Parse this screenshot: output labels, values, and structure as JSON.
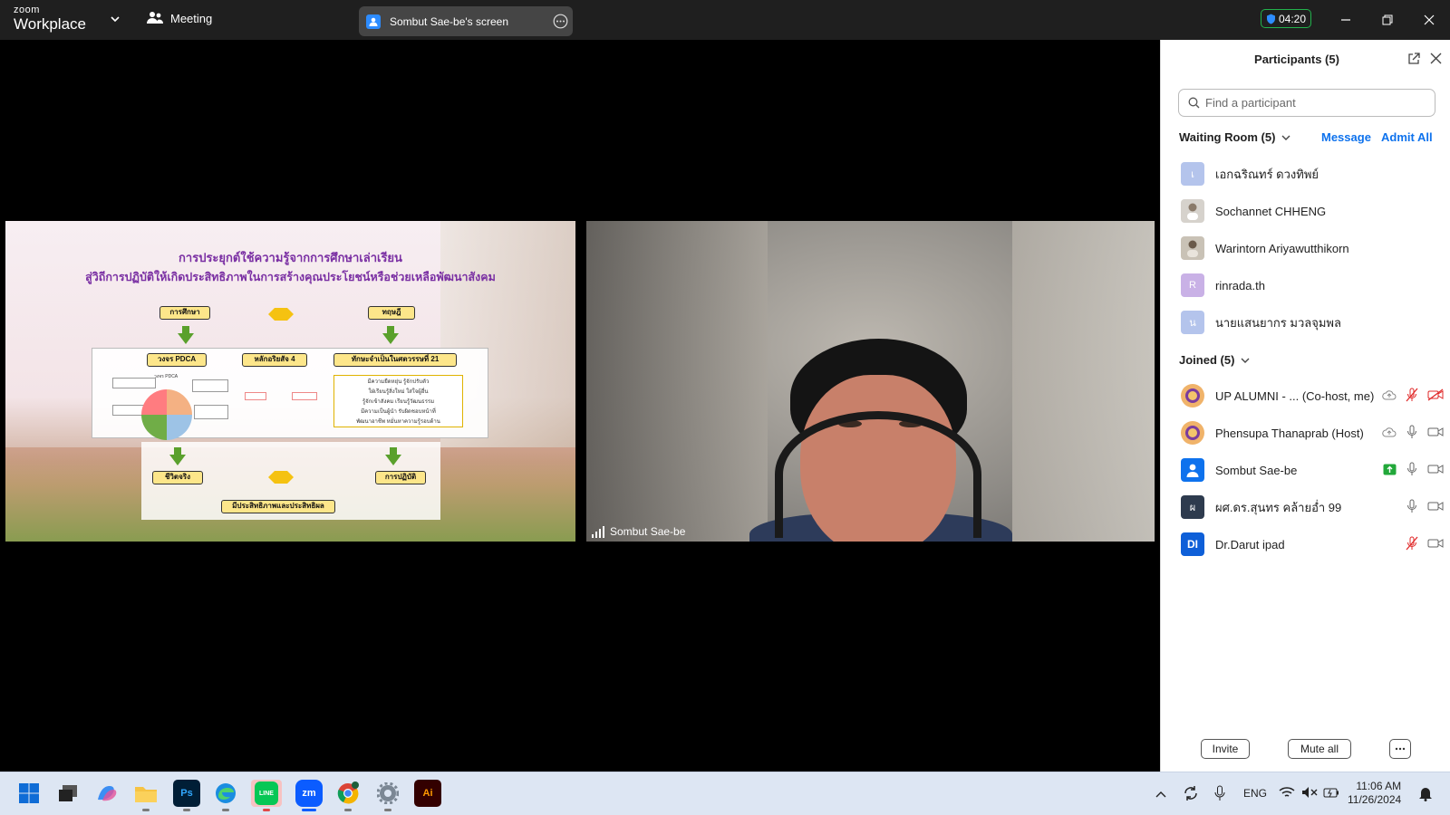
{
  "titlebar": {
    "brand_small": "zoom",
    "brand_big": "Workplace",
    "meeting_label": "Meeting",
    "share_label": "Sombut Sae-be's screen",
    "timer": "04:20"
  },
  "slide": {
    "title_line1": "การประยุกต์ใช้ความรู้จากการศึกษาเล่าเรียน",
    "title_line2": "สู่วิถีการปฏิบัติให้เกิดประสิทธิภาพในการสร้างคุณประโยชน์หรือช่วยเหลือพัฒนาสังคม",
    "box_study": "การศึกษา",
    "box_theory": "ทฤษฎี",
    "box_pdca": "วงจร PDCA",
    "box_principle": "หลักอริยสัจ 4",
    "box_skills": "ทักษะจำเป็นในศตวรรษที่ 21",
    "box_reallife": "ชีวิตจริง",
    "box_practice": "การปฏิบัติ",
    "box_result": "มีประสิทธิภาพและประสิทธิผล",
    "pdca_label": "วงจร PDCA",
    "skills_lines": [
      "มีความยืดหยุ่น รู้จักปรับตัว",
      "ใฝ่เรียนรู้สิ่งใหม่ ใส่ใจผู้อื่น",
      "รู้จักเข้าสังคม เรียนรู้วัฒนธรรม",
      "มีความเป็นผู้นำ รับผิดชอบหน้าที่",
      "พัฒนาอาชีพ หมั่นหาความรู้รอบด้าน"
    ]
  },
  "video": {
    "name": "Sombut Sae-be"
  },
  "panel": {
    "title": "Participants (5)",
    "search_placeholder": "Find a participant",
    "waiting_label": "Waiting Room (5)",
    "message_label": "Message",
    "admit_all_label": "Admit All",
    "joined_label": "Joined (5)",
    "waiting": [
      {
        "name": "เอกฉริณทร์ ดวงทิพย์",
        "initial": "เ",
        "color": "#b4c4ec"
      },
      {
        "name": "Sochannet CHHENG",
        "initial": "",
        "color": "#d6d2cc"
      },
      {
        "name": "Warintorn Ariyawutthikorn",
        "initial": "",
        "color": "#c9c2b6"
      },
      {
        "name": "rinrada.th",
        "initial": "R",
        "color": "#c9b1e6"
      },
      {
        "name": "นายแสนยากร มวลจุมพล",
        "initial": "น",
        "color": "#b4c4ec"
      }
    ],
    "joined": [
      {
        "name": "UP ALUMNI - ...  (Co-host, me)",
        "initial": "",
        "color": "#f0b36a"
      },
      {
        "name": "Phensupa Thanaprab (Host)",
        "initial": "",
        "color": "#f0b36a"
      },
      {
        "name": "Sombut Sae-be",
        "initial": "",
        "color": "#0e72ed"
      },
      {
        "name": "ผศ.ดร.สุนทร คล้ายอ่ำ 99",
        "initial": "ผ",
        "color": "#2e3b4e"
      },
      {
        "name": "Dr.Darut ipad",
        "initial": "DI",
        "color": "#0e5fd8"
      }
    ],
    "invite_label": "Invite",
    "mute_all_label": "Mute all"
  },
  "taskbar": {
    "lang": "ENG",
    "time": "11:06 AM",
    "date": "11/26/2024",
    "apps": [
      "start-icon",
      "task-view-icon",
      "copilot-icon",
      "file-explorer-icon",
      "photoshop-icon",
      "edge-icon",
      "line-icon",
      "zoom-icon",
      "chrome-icon",
      "settings-icon",
      "illustrator-icon"
    ],
    "ps_label": "Ps",
    "zoom_label": "zm",
    "ai_label": "Ai",
    "line_label": "LINE"
  }
}
